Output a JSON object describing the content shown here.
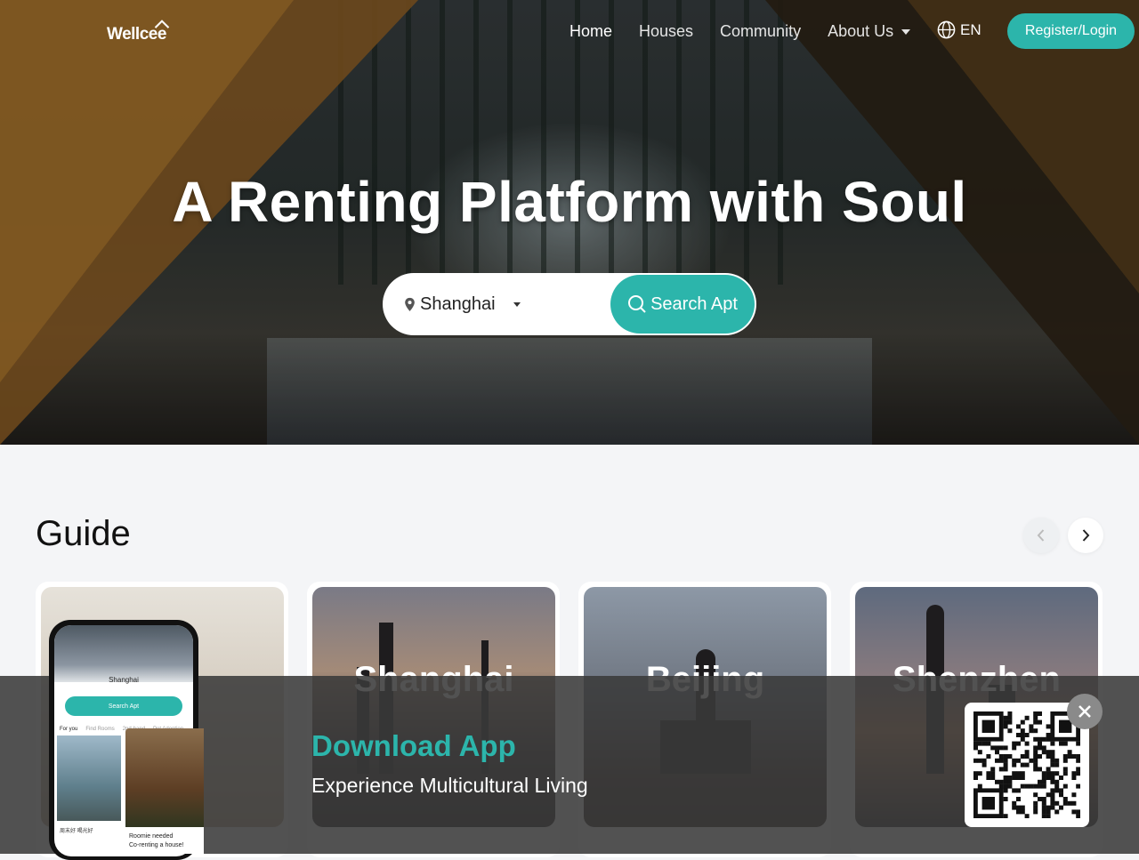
{
  "brand": {
    "logo_text": "Wellcee"
  },
  "nav": {
    "items": [
      {
        "label": "Home"
      },
      {
        "label": "Houses"
      },
      {
        "label": "Community"
      },
      {
        "label": "About Us"
      }
    ],
    "language": "EN",
    "register_label": "Register/Login"
  },
  "hero": {
    "headline": "A Renting Platform with Soul",
    "city": "Shanghai",
    "search_label": "Search Apt"
  },
  "guide": {
    "title": "Guide",
    "cards": [
      {
        "title": ""
      },
      {
        "title": "Shanghai"
      },
      {
        "title": "Beijing"
      },
      {
        "title": "Shenzhen"
      }
    ]
  },
  "download_banner": {
    "title": "Download App",
    "subtitle": "Experience Multicultural Living",
    "phone": {
      "city": "Shanghai",
      "search_label": "Search Apt",
      "tabs": [
        "For you",
        "Find Rooms",
        "2nd-hand",
        "Pet Adoption"
      ],
      "post_caption": "周末好 喝光好",
      "post2_caption_line1": "Roomie needed",
      "post2_caption_line2": "Co-renting a house!"
    }
  },
  "colors": {
    "accent": "#2cb5ab",
    "banner_bg": "#3a3a3a"
  },
  "icons": [
    "pin-icon",
    "search-icon",
    "globe-icon",
    "chevron-left-icon",
    "chevron-right-icon",
    "close-icon",
    "qr-code-icon"
  ]
}
